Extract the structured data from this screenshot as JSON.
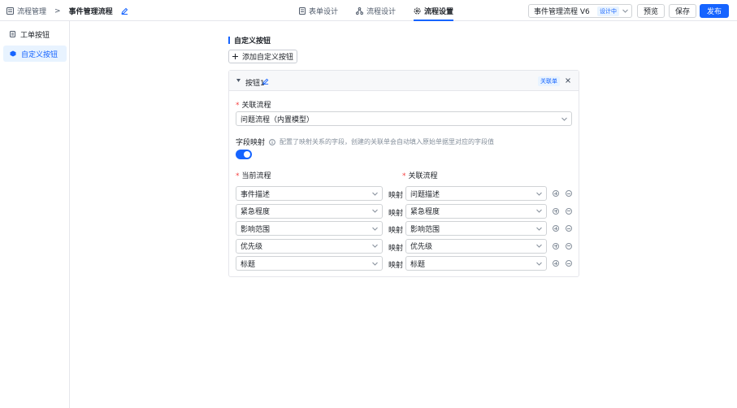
{
  "breadcrumb": {
    "parent": "流程管理",
    "separator": ">",
    "current": "事件管理流程"
  },
  "tabs": [
    {
      "label": "表单设计",
      "icon": "document-icon"
    },
    {
      "label": "流程设计",
      "icon": "flow-icon"
    },
    {
      "label": "流程设置",
      "icon": "gear-icon",
      "active": true
    }
  ],
  "version": {
    "name": "事件管理流程 V6",
    "status": "设计中"
  },
  "actions": {
    "preview": "预览",
    "save": "保存",
    "publish": "发布"
  },
  "sidebar": {
    "items": [
      {
        "label": "工单按钮",
        "icon": "document-icon"
      },
      {
        "label": "自定义按钮",
        "icon": "cube-icon",
        "active": true
      }
    ]
  },
  "section": {
    "title": "自定义按钮",
    "add_button": "添加自定义按钮"
  },
  "card": {
    "name": "按钮1",
    "badge": "关联单",
    "related_flow_label": "关联流程",
    "related_flow_value": "问题流程（内置模型）",
    "field_mapping_label": "字段映射",
    "field_mapping_hint": "配置了映射关系的字段，创建的关联单会自动填入原始单据里对应的字段值",
    "field_mapping_enabled": true,
    "col_current": "当前流程",
    "col_related": "关联流程",
    "map_word": "映射",
    "mappings": [
      {
        "current": "事件描述",
        "related": "问题描述"
      },
      {
        "current": "紧急程度",
        "related": "紧急程度"
      },
      {
        "current": "影响范围",
        "related": "影响范围"
      },
      {
        "current": "优先级",
        "related": "优先级"
      },
      {
        "current": "标题",
        "related": "标题"
      }
    ]
  },
  "colors": {
    "accent": "#1664ff",
    "required": "#f53f3f"
  }
}
